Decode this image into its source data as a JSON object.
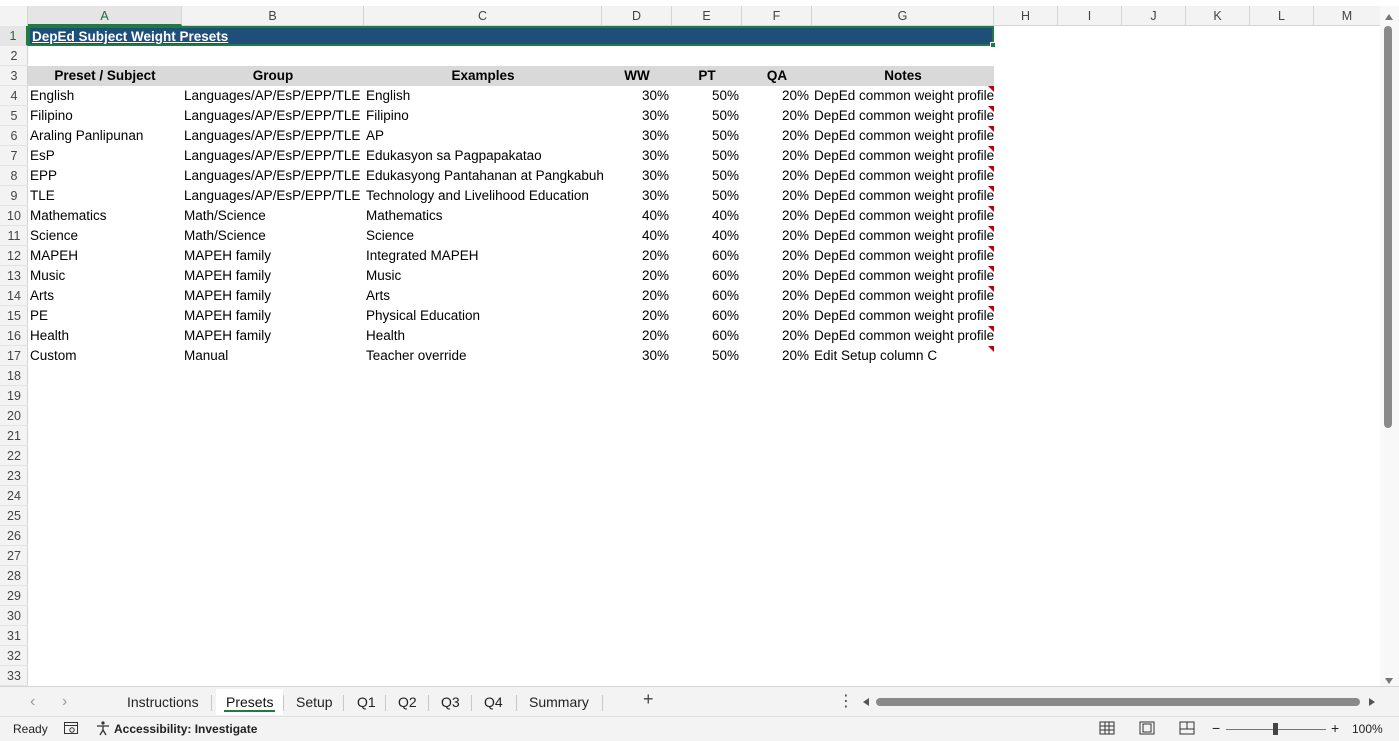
{
  "columns": [
    "A",
    "B",
    "C",
    "D",
    "E",
    "F",
    "G",
    "H",
    "I",
    "J",
    "K",
    "L",
    "M"
  ],
  "rows": [
    "1",
    "2",
    "3",
    "4",
    "5",
    "6",
    "7",
    "8",
    "9",
    "10",
    "11",
    "12",
    "13",
    "14",
    "15",
    "16",
    "17",
    "18",
    "19",
    "20",
    "21",
    "22",
    "23",
    "24",
    "25",
    "26",
    "27",
    "28",
    "29",
    "30",
    "31",
    "32",
    "33"
  ],
  "title": "DepEd Subject Weight Presets",
  "table": {
    "headers": [
      "Preset / Subject",
      "Group",
      "Examples",
      "WW",
      "PT",
      "QA",
      "Notes"
    ],
    "rows": [
      [
        "English",
        "Languages/AP/EsP/EPP/TLE",
        "English",
        "30%",
        "50%",
        "20%",
        "DepEd common weight profile"
      ],
      [
        "Filipino",
        "Languages/AP/EsP/EPP/TLE",
        "Filipino",
        "30%",
        "50%",
        "20%",
        "DepEd common weight profile"
      ],
      [
        "Araling Panlipunan",
        "Languages/AP/EsP/EPP/TLE",
        "AP",
        "30%",
        "50%",
        "20%",
        "DepEd common weight profile"
      ],
      [
        "EsP",
        "Languages/AP/EsP/EPP/TLE",
        "Edukasyon sa Pagpapakatao",
        "30%",
        "50%",
        "20%",
        "DepEd common weight profile"
      ],
      [
        "EPP",
        "Languages/AP/EsP/EPP/TLE",
        "Edukasyong Pantahanan at Pangkabuh",
        "30%",
        "50%",
        "20%",
        "DepEd common weight profile"
      ],
      [
        "TLE",
        "Languages/AP/EsP/EPP/TLE",
        "Technology and Livelihood Education",
        "30%",
        "50%",
        "20%",
        "DepEd common weight profile"
      ],
      [
        "Mathematics",
        "Math/Science",
        "Mathematics",
        "40%",
        "40%",
        "20%",
        "DepEd common weight profile"
      ],
      [
        "Science",
        "Math/Science",
        "Science",
        "40%",
        "40%",
        "20%",
        "DepEd common weight profile"
      ],
      [
        "MAPEH",
        "MAPEH family",
        "Integrated MAPEH",
        "20%",
        "60%",
        "20%",
        "DepEd common weight profile"
      ],
      [
        "Music",
        "MAPEH family",
        "Music",
        "20%",
        "60%",
        "20%",
        "DepEd common weight profile"
      ],
      [
        "Arts",
        "MAPEH family",
        "Arts",
        "20%",
        "60%",
        "20%",
        "DepEd common weight profile"
      ],
      [
        "PE",
        "MAPEH family",
        "Physical Education",
        "20%",
        "60%",
        "20%",
        "DepEd common weight profile"
      ],
      [
        "Health",
        "MAPEH family",
        "Health",
        "20%",
        "60%",
        "20%",
        "DepEd common weight profile"
      ],
      [
        "Custom",
        "Manual",
        "Teacher override",
        "30%",
        "50%",
        "20%",
        "Edit Setup column C"
      ]
    ]
  },
  "sheet_tabs": [
    "Instructions",
    "Presets",
    "Setup",
    "Q1",
    "Q2",
    "Q3",
    "Q4",
    "Summary"
  ],
  "active_tab": "Presets",
  "add_sheet": "+",
  "more_dots": "⋮",
  "status": {
    "ready": "Ready",
    "accessibility": "Accessibility: Investigate",
    "zoom_minus": "−",
    "zoom_plus": "+",
    "zoom": "100%"
  },
  "colors": {
    "title_fill": "#1f4e79",
    "header_fill": "#d9d9d9",
    "selection": "#1f7a45",
    "comment_marker": "#c00000"
  }
}
